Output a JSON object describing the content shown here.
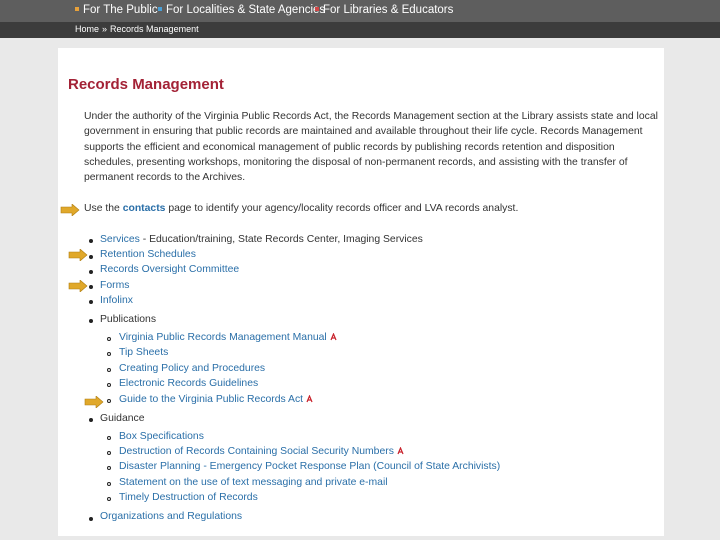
{
  "topnav": {
    "items": [
      {
        "label": "For The Public",
        "color": "#e8a13a"
      },
      {
        "label": "For Localities & State Agencies",
        "color": "#4a9fd6"
      },
      {
        "label": "For Libraries & Educators",
        "color": "#d04545"
      }
    ]
  },
  "breadcrumb": {
    "home": "Home",
    "separator": "»",
    "current": "Records Management"
  },
  "page": {
    "title": "Records Management",
    "intro": "Under the authority of the Virginia Public Records Act, the Records Management section at the Library assists state and local government in ensuring that public records are maintained and available throughout their life cycle. Records Management supports the efficient and economical management of public records by publishing records retention and disposition schedules, presenting workshops, monitoring the disposal of non-permanent records, and assisting with the transfer of permanent records to the Archives.",
    "contact_prefix": "Use the ",
    "contact_link": "contacts",
    "contact_suffix": " page to identify your agency/locality records officer and LVA records analyst."
  },
  "list": {
    "services_link": "Services",
    "services_rest": " - Education/training, State Records Center, Imaging Services",
    "retention": "Retention Schedules",
    "oversight": "Records Oversight Committee",
    "forms": "Forms",
    "infolinx": "Infolinx",
    "publications": "Publications",
    "pub_manual": "Virginia Public Records Management Manual",
    "pub_tips": "Tip Sheets",
    "pub_policy": "Creating Policy and Procedures",
    "pub_electronic": "Electronic Records Guidelines",
    "pub_guide": "Guide to the Virginia Public Records Act",
    "guidance": "Guidance",
    "g_box": "Box Specifications",
    "g_ssn": "Destruction of Records Containing Social Security Numbers",
    "g_disaster": "Disaster Planning - Emergency Pocket Response Plan (Council of State Archivists)",
    "g_text": "Statement on the use of text messaging and private e-mail",
    "g_timely": "Timely Destruction of Records",
    "organizations": "Organizations and Regulations"
  },
  "icons": {
    "pdf": "pdf-icon",
    "arrow": "arrow-pointer-icon"
  },
  "colors": {
    "title": "#a32236",
    "link": "#2a6fa8",
    "arrow": "#e0a82a"
  }
}
